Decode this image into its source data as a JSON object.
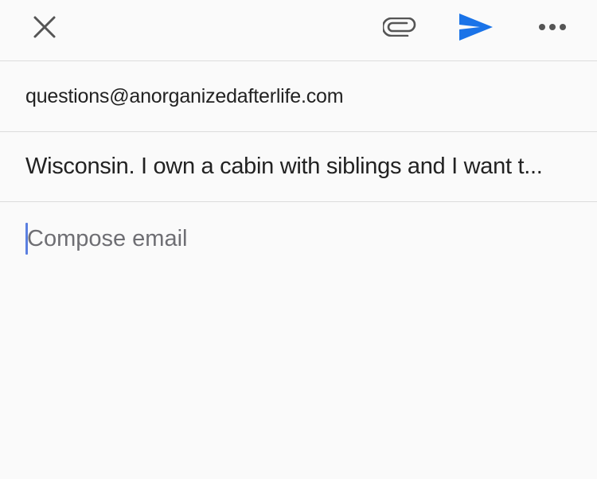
{
  "toolbar": {
    "close_icon": "close-icon",
    "attach_icon": "paperclip-icon",
    "send_icon": "send-icon",
    "more_icon": "more-horizontal-icon",
    "send_color": "#1a73e8",
    "icon_color": "#555555"
  },
  "compose": {
    "to": "questions@anorganizedafterlife.com",
    "subject": "Wisconsin. I own a cabin with siblings and I want t...",
    "body_placeholder": "Compose email",
    "body_value": ""
  }
}
